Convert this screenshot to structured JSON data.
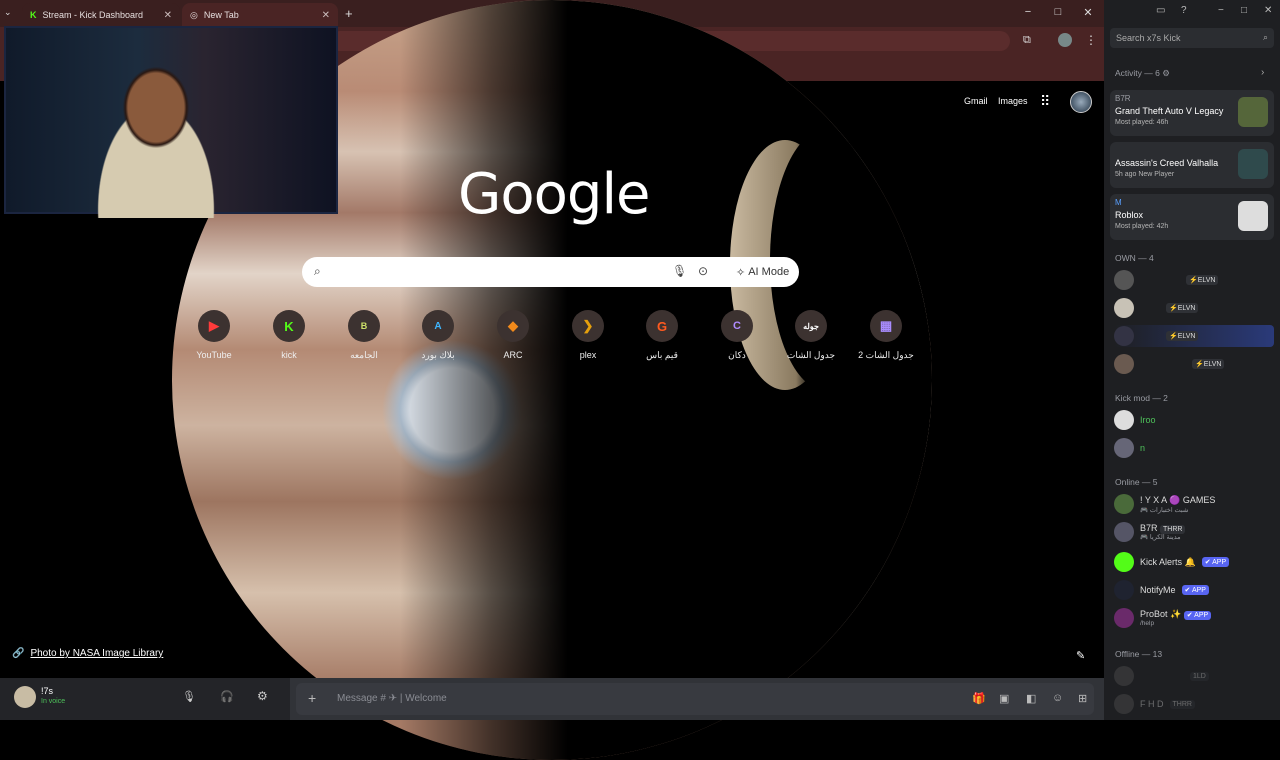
{
  "tabs": [
    {
      "title": "Stream - Kick Dashboard",
      "icon": "kick-icon"
    },
    {
      "title": "New Tab",
      "icon": "chrome-icon"
    }
  ],
  "window_controls": {
    "minimize": "−",
    "maximize": "□",
    "close": "✕"
  },
  "google": {
    "header_links": [
      "Gmail",
      "Images"
    ],
    "logo": "Google",
    "search_placeholder": "",
    "ai_mode_label": "AI Mode",
    "shortcuts": [
      {
        "label": "YouTube",
        "glyph": "▶"
      },
      {
        "label": "kick",
        "glyph": "K"
      },
      {
        "label": "الجامعه",
        "glyph": "B"
      },
      {
        "label": "بلاك بورد",
        "glyph": "A"
      },
      {
        "label": "ARC",
        "glyph": "◆"
      },
      {
        "label": "plex",
        "glyph": "❯"
      },
      {
        "label": "قيم باس",
        "glyph": "G"
      },
      {
        "label": "دكان",
        "glyph": "C"
      },
      {
        "label": "جدول الشات",
        "glyph": "جوله"
      },
      {
        "label": "جدول الشات 2",
        "glyph": "▦"
      }
    ],
    "photo_credit": "Photo by NASA Image Library"
  },
  "discord": {
    "search_placeholder": "Search x7s Kick",
    "activity_header": "Activity — 6",
    "activity": [
      {
        "user": "B7R",
        "game": "Grand Theft Auto V Legacy",
        "meta": "Most played: 46h"
      },
      {
        "user": "",
        "game": "Assassin's Creed Valhalla",
        "meta": "5h ago   New Player"
      },
      {
        "user": "M",
        "game": "Roblox",
        "meta": "Most played: 42h"
      }
    ],
    "own_header": "OWN — 4",
    "own_members": [
      {
        "tag": "⚡ELVN"
      },
      {
        "tag": "⚡ELVN"
      },
      {
        "tag": "⚡ELVN"
      },
      {
        "tag": "⚡ELVN"
      }
    ],
    "kickmod_header": "Kick mod — 2",
    "kickmod_members": [
      {
        "name": "Iroo"
      },
      {
        "name": "n"
      }
    ],
    "online_header": "Online — 5",
    "online_members": [
      {
        "name": "! Y X A 🟣 GAMES",
        "sub": "🎮 شبت اختبارات"
      },
      {
        "name": "B7R",
        "tag": "THRR",
        "sub": "🎮 مدينة الكريا"
      },
      {
        "name": "Kick Alerts 🔔",
        "badge": "✔ APP"
      },
      {
        "name": "NotifyMe",
        "badge": "✔ APP"
      },
      {
        "name": "ProBot ✨",
        "badge": "✔ APP",
        "sub": "/help"
      }
    ],
    "offline_header": "Offline — 13",
    "offline_members": [
      {
        "tag": "1LD"
      },
      {
        "name": "F H D",
        "tag": "THRR"
      }
    ],
    "user": {
      "name": "!7s",
      "status": "In voice"
    },
    "message_placeholder": "Message # ✈  |  Welcome"
  }
}
